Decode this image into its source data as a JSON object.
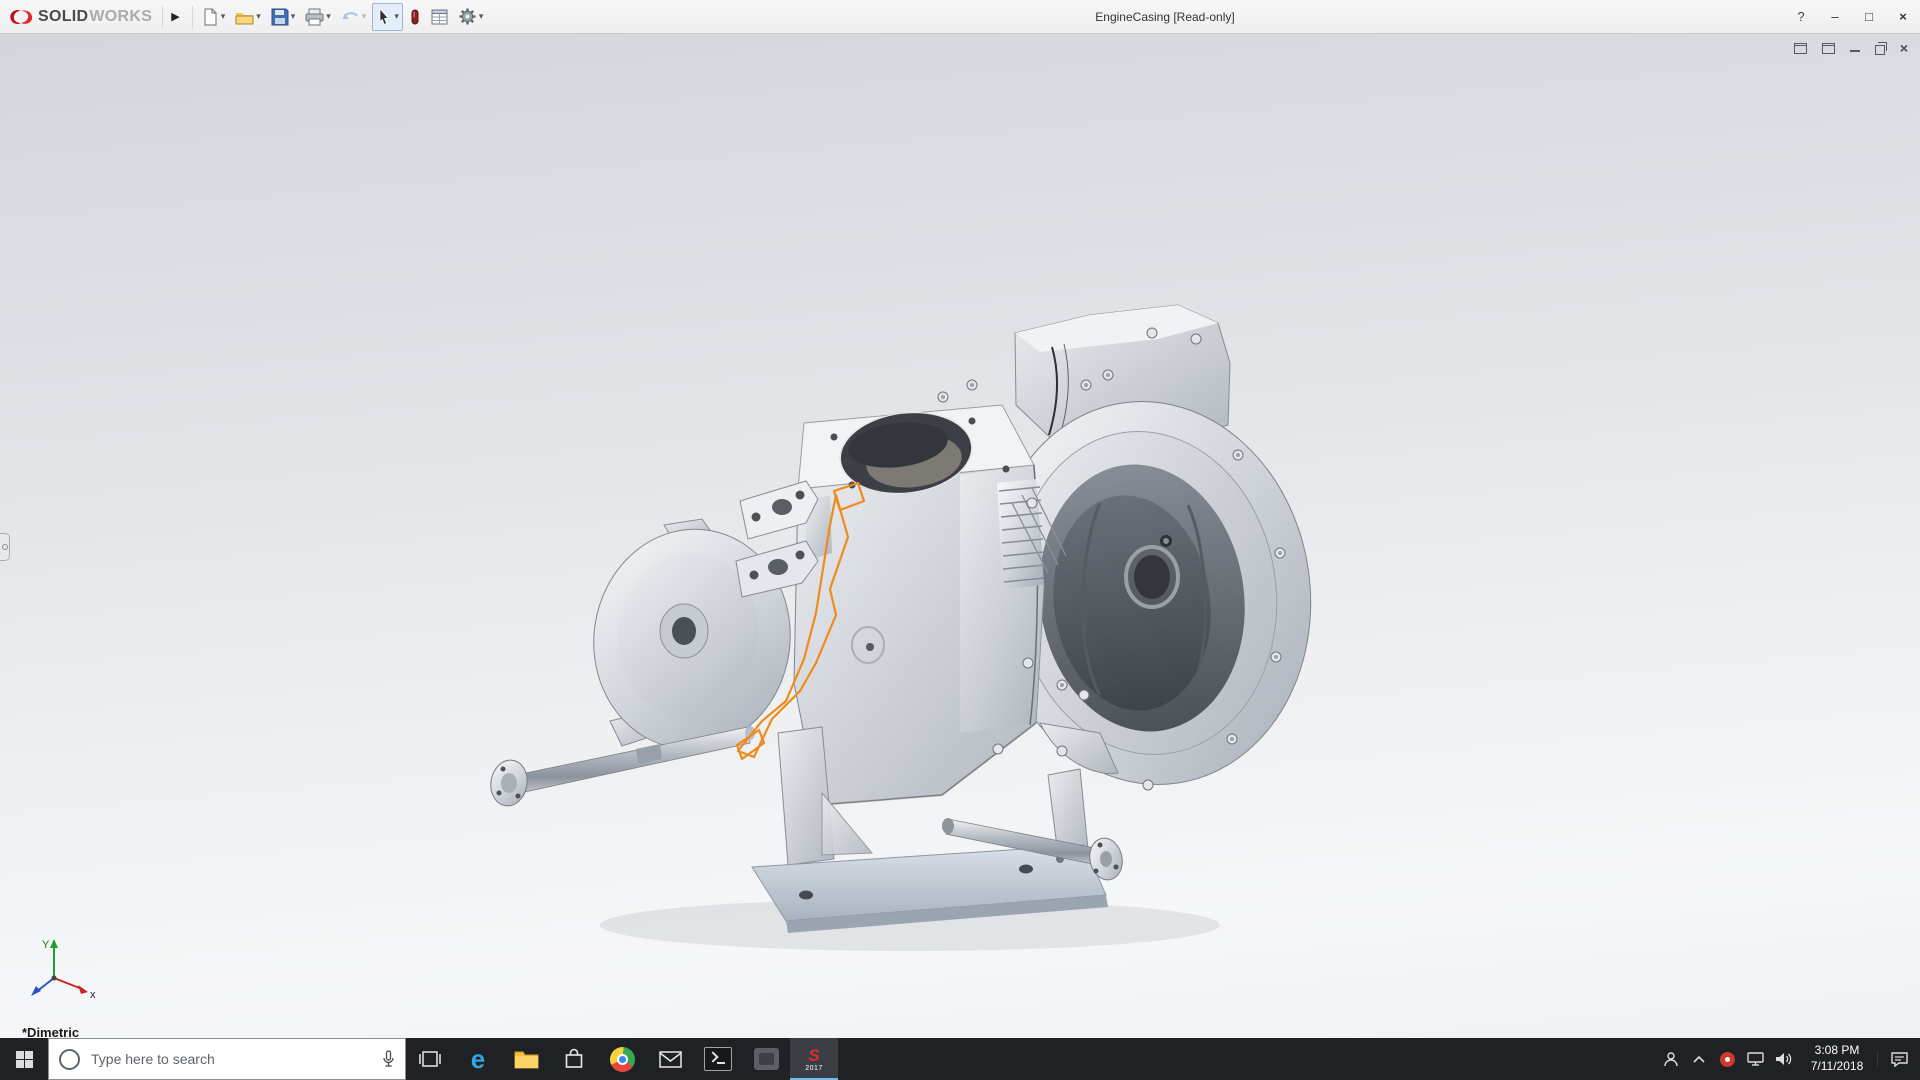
{
  "titlebar": {
    "brand": {
      "solid": "SOLID",
      "works": "WORKS"
    },
    "document_title": "EngineCasing [Read-only]",
    "help_label": "?"
  },
  "icons": {
    "flyout": "▶",
    "dropdown": "▾",
    "minimize": "–",
    "maximize": "□",
    "close": "×",
    "edge": "e"
  },
  "viewport": {
    "view_orientation_label": "*Dimetric",
    "triad": {
      "x_label": "x",
      "y_label": "Y"
    }
  },
  "taskbar": {
    "search_placeholder": "Type here to search",
    "solidworks_badge": {
      "letter": "S",
      "year": "2017"
    },
    "clock": {
      "time": "3:08 PM",
      "date": "7/11/2018"
    }
  },
  "colors": {
    "sketch_orange": "#ef8b1c",
    "solidworks_red": "#d42029",
    "taskbar_active_accent": "#76b9ed"
  }
}
